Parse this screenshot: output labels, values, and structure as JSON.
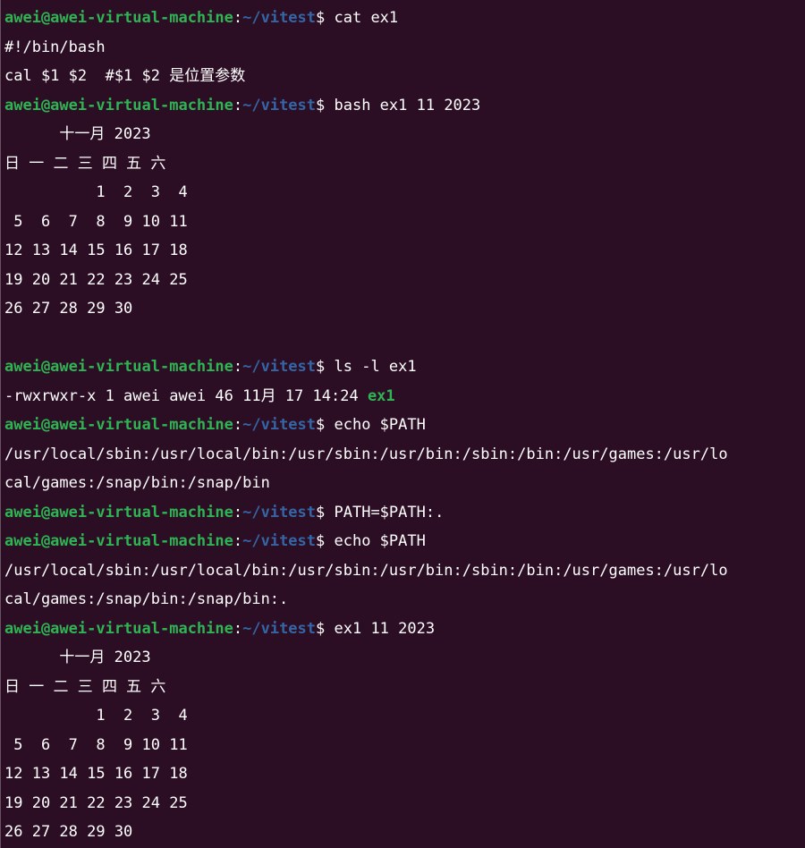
{
  "prompt": {
    "user_host": "awei@awei-virtual-machine",
    "sep": ":",
    "path": "~/vitest",
    "dollar": "$"
  },
  "lines": [
    {
      "type": "prompt",
      "cmd": " cat ex1"
    },
    {
      "type": "out",
      "text": "#!/bin/bash"
    },
    {
      "type": "out",
      "text": "cal $1 $2  #$1 $2 是位置参数"
    },
    {
      "type": "prompt",
      "cmd": " bash ex1 11 2023"
    },
    {
      "type": "out",
      "text": "      十一月 2023"
    },
    {
      "type": "out",
      "text": "日 一 二 三 四 五 六"
    },
    {
      "type": "out",
      "text": "          1  2  3  4"
    },
    {
      "type": "out",
      "text": " 5  6  7  8  9 10 11"
    },
    {
      "type": "out",
      "text": "12 13 14 15 16 17 18"
    },
    {
      "type": "out",
      "text": "19 20 21 22 23 24 25"
    },
    {
      "type": "out",
      "text": "26 27 28 29 30"
    },
    {
      "type": "out",
      "text": ""
    },
    {
      "type": "prompt",
      "cmd": " ls -l ex1"
    },
    {
      "type": "ls",
      "text": "-rwxrwxr-x 1 awei awei 46 11月 17 14:24 ",
      "file": "ex1"
    },
    {
      "type": "prompt",
      "cmd": " echo $PATH"
    },
    {
      "type": "out",
      "text": "/usr/local/sbin:/usr/local/bin:/usr/sbin:/usr/bin:/sbin:/bin:/usr/games:/usr/lo"
    },
    {
      "type": "out",
      "text": "cal/games:/snap/bin:/snap/bin"
    },
    {
      "type": "prompt",
      "cmd": " PATH=$PATH:."
    },
    {
      "type": "prompt",
      "cmd": " echo $PATH"
    },
    {
      "type": "out",
      "text": "/usr/local/sbin:/usr/local/bin:/usr/sbin:/usr/bin:/sbin:/bin:/usr/games:/usr/lo"
    },
    {
      "type": "out",
      "text": "cal/games:/snap/bin:/snap/bin:."
    },
    {
      "type": "prompt",
      "cmd": " ex1 11 2023"
    },
    {
      "type": "out",
      "text": "      十一月 2023"
    },
    {
      "type": "out",
      "text": "日 一 二 三 四 五 六"
    },
    {
      "type": "out",
      "text": "          1  2  3  4"
    },
    {
      "type": "out",
      "text": " 5  6  7  8  9 10 11"
    },
    {
      "type": "out",
      "text": "12 13 14 15 16 17 18"
    },
    {
      "type": "out",
      "text": "19 20 21 22 23 24 25"
    },
    {
      "type": "out",
      "text": "26 27 28 29 30"
    }
  ]
}
